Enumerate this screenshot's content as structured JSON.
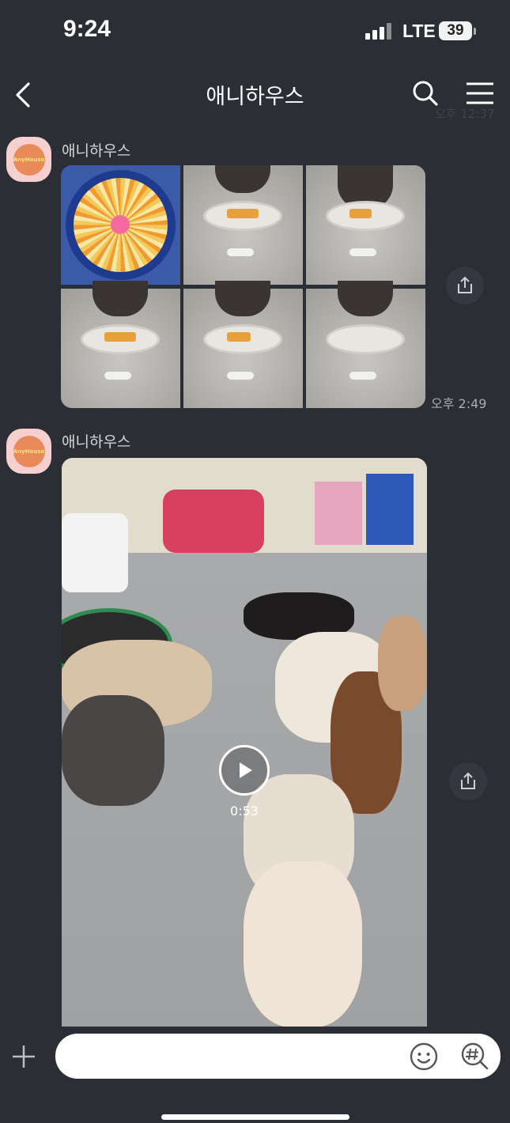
{
  "status_bar": {
    "time": "9:24",
    "network": "LTE",
    "battery": "39"
  },
  "header": {
    "title": "애니하우스",
    "icons": [
      "back-arrow-icon",
      "search-icon",
      "menu-icon"
    ]
  },
  "ghost_time": "오후 12:37",
  "messages": [
    {
      "sender": "애니하우스",
      "avatar_label": "AnyHouse",
      "type": "photos",
      "photo_count": 6,
      "time": "오후 2:49"
    },
    {
      "sender": "애니하우스",
      "avatar_label": "AnyHouse",
      "type": "video",
      "duration": "0:53"
    }
  ],
  "input": {
    "placeholder": "",
    "icons": [
      "plus-icon",
      "emoji-icon",
      "hashtag-search-icon"
    ]
  },
  "colors": {
    "background": "#2b2e35",
    "input_bg": "#ffffff",
    "avatar_bg": "#f6cfcf"
  }
}
